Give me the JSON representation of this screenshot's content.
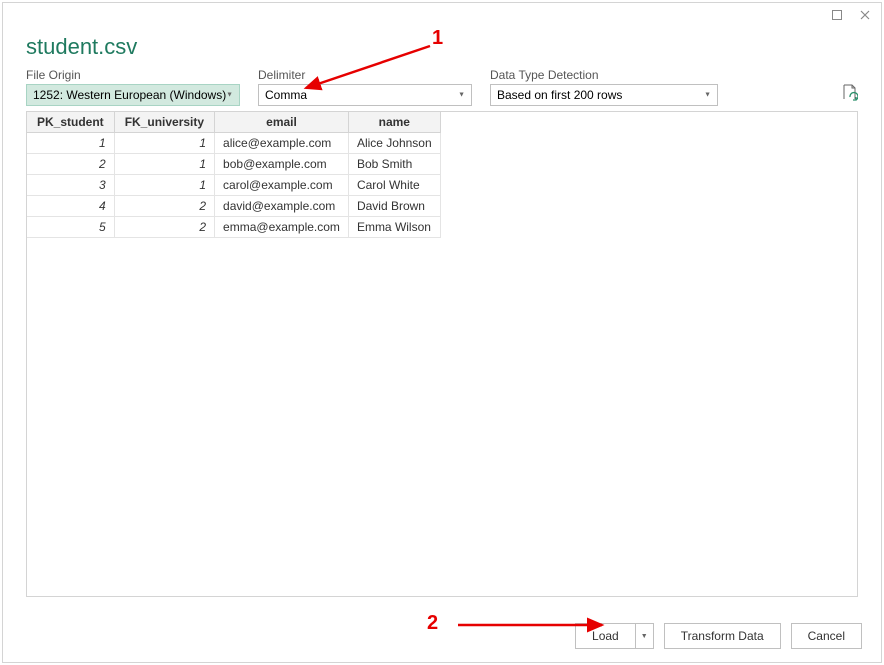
{
  "title": "student.csv",
  "options": {
    "fileorigin": {
      "label": "File Origin",
      "value": "1252: Western European (Windows)"
    },
    "delimiter": {
      "label": "Delimiter",
      "value": "Comma"
    },
    "datatype": {
      "label": "Data Type Detection",
      "value": "Based on first 200 rows"
    }
  },
  "table": {
    "headers": [
      "PK_student",
      "FK_university",
      "email",
      "name"
    ],
    "rows": [
      {
        "pk": "1",
        "fk": "1",
        "email": "alice@example.com",
        "name": "Alice Johnson"
      },
      {
        "pk": "2",
        "fk": "1",
        "email": "bob@example.com",
        "name": "Bob Smith"
      },
      {
        "pk": "3",
        "fk": "1",
        "email": "carol@example.com",
        "name": "Carol White"
      },
      {
        "pk": "4",
        "fk": "2",
        "email": "david@example.com",
        "name": "David Brown"
      },
      {
        "pk": "5",
        "fk": "2",
        "email": "emma@example.com",
        "name": "Emma Wilson"
      }
    ]
  },
  "footer": {
    "load": "Load",
    "transform": "Transform Data",
    "cancel": "Cancel"
  },
  "annotations": {
    "n1": "1",
    "n2": "2"
  }
}
